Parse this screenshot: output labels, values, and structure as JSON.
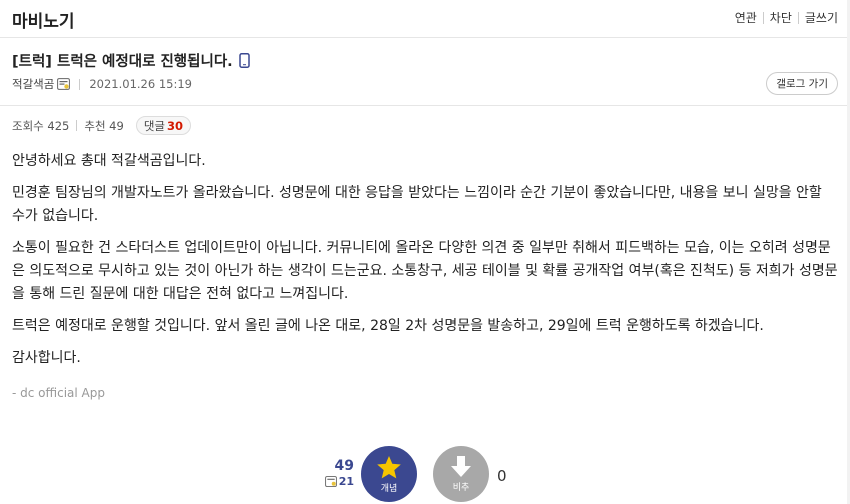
{
  "header": {
    "gallery_name": "마비노기",
    "links": [
      "연관",
      "차단",
      "글쓰기"
    ]
  },
  "post": {
    "title": "[트럭] 트럭은 예정대로 진행됩니다.",
    "author": "적갈색곰",
    "date": "2021.01.26 15:19",
    "back_button": "갤로그 가기",
    "views_label": "조회수 425",
    "recommend_label": "추천 49",
    "comment_label": "댓글",
    "comment_count": "30",
    "paragraphs": [
      "안녕하세요 총대 적갈색곰입니다.",
      "민경훈 팀장님의 개발자노트가 올라왔습니다. 성명문에 대한 응답을 받았다는 느낌이라 순간 기분이 좋았습니다만, 내용을 보니 실망을 안할 수가 없습니다.",
      "소통이 필요한 건 스타더스트 업데이트만이 아닙니다. 커뮤니티에 올라온 다양한 의견 중 일부만 취해서 피드백하는 모습, 이는 오히려 성명문은 의도적으로 무시하고 있는 것이 아닌가 하는 생각이 드는군요. 소통창구, 세공 테이블 및 확률 공개작업 여부(혹은 진척도) 등 저희가 성명문을 통해 드린 질문에 대한 대답은 전혀 없다고 느껴집니다.",
      "트럭은 예정대로 운행할 것입니다. 앞서 올린 글에 나온 대로, 28일 2차 성명문을 발송하고, 29일에 트럭 운행하도록 하겠습니다.",
      "감사합니다."
    ],
    "signature": "- dc official App"
  },
  "vote": {
    "recommend_count": "49",
    "fixed_count": "21",
    "up_label": "개념",
    "down_label": "비추",
    "down_count": "0"
  },
  "icons": {
    "phone": "mobile-phone-icon",
    "member": "fixed-member-icon",
    "star": "star-icon",
    "down_arrow": "down-arrow-icon"
  },
  "colors": {
    "accent": "#3b4890",
    "comment_count": "#d31900",
    "down_button": "#a8a8a8"
  }
}
